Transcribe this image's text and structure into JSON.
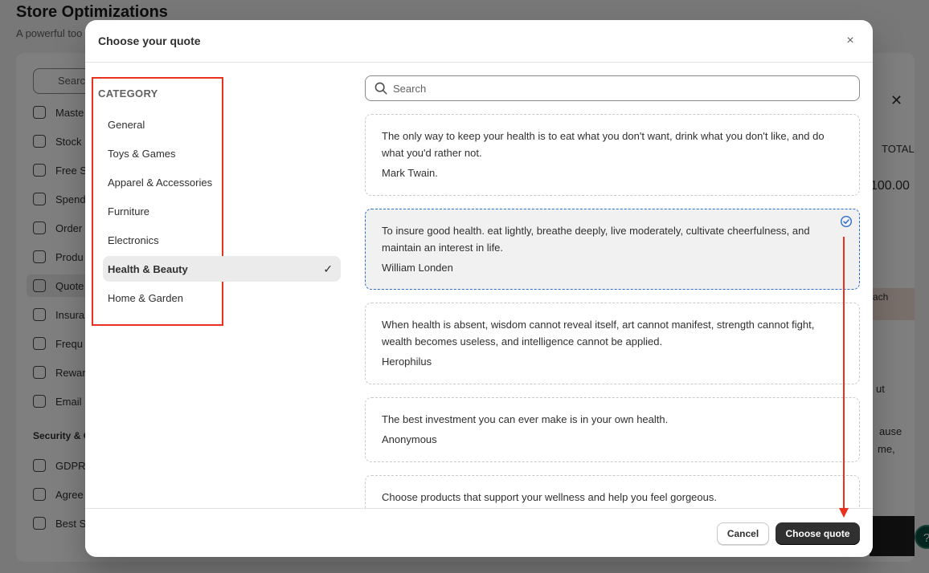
{
  "background": {
    "title": "Store Optimizations",
    "subtitle": "A powerful too",
    "search_placeholder": "Searc",
    "nav_items": [
      "Maste",
      "Stock",
      "Free S",
      "Spend",
      "Order",
      "Produ",
      "Quote",
      "Insura",
      "Frequ",
      "Rewar",
      "Email"
    ],
    "section_label": "Security & C",
    "security_items": [
      "GDPR",
      "Agree",
      "Best S"
    ],
    "total_label": "TOTAL",
    "amount": "100.00",
    "tan_label": "ach",
    "snippet_1": "ut",
    "snippet_2": "ause",
    "snippet_3": "me,",
    "help": "?"
  },
  "modal": {
    "title": "Choose your quote",
    "close": "×",
    "category_heading": "CATEGORY",
    "categories": [
      {
        "label": "General"
      },
      {
        "label": "Toys & Games"
      },
      {
        "label": "Apparel & Accessories"
      },
      {
        "label": "Furniture"
      },
      {
        "label": "Electronics"
      },
      {
        "label": "Health & Beauty",
        "selected": true
      },
      {
        "label": "Home & Garden"
      }
    ],
    "check_glyph": "✓",
    "search_placeholder": "Search",
    "quotes": [
      {
        "text": "The only way to keep your health is to eat what you don't want, drink what you don't like, and do what you'd rather not.",
        "author": "Mark Twain."
      },
      {
        "text": "To insure good health. eat lightly, breathe deeply, live moderately, cultivate cheerfulness, and maintain an interest in life.",
        "author": "William Londen",
        "selected": true
      },
      {
        "text": "When health is absent, wisdom cannot reveal itself, art cannot manifest, strength cannot fight, wealth becomes useless, and intelligence cannot be applied.",
        "author": "Herophilus"
      },
      {
        "text": "The best investment you can ever make is in your own health.",
        "author": "Anonymous"
      },
      {
        "text": "Choose products that support your wellness and help you feel gorgeous.",
        "author": ""
      }
    ],
    "cancel_label": "Cancel",
    "confirm_label": "Choose quote"
  },
  "colors": {
    "annotation": "#e8321e",
    "selected_border": "#2c6ecb",
    "primary_button": "#303030"
  }
}
